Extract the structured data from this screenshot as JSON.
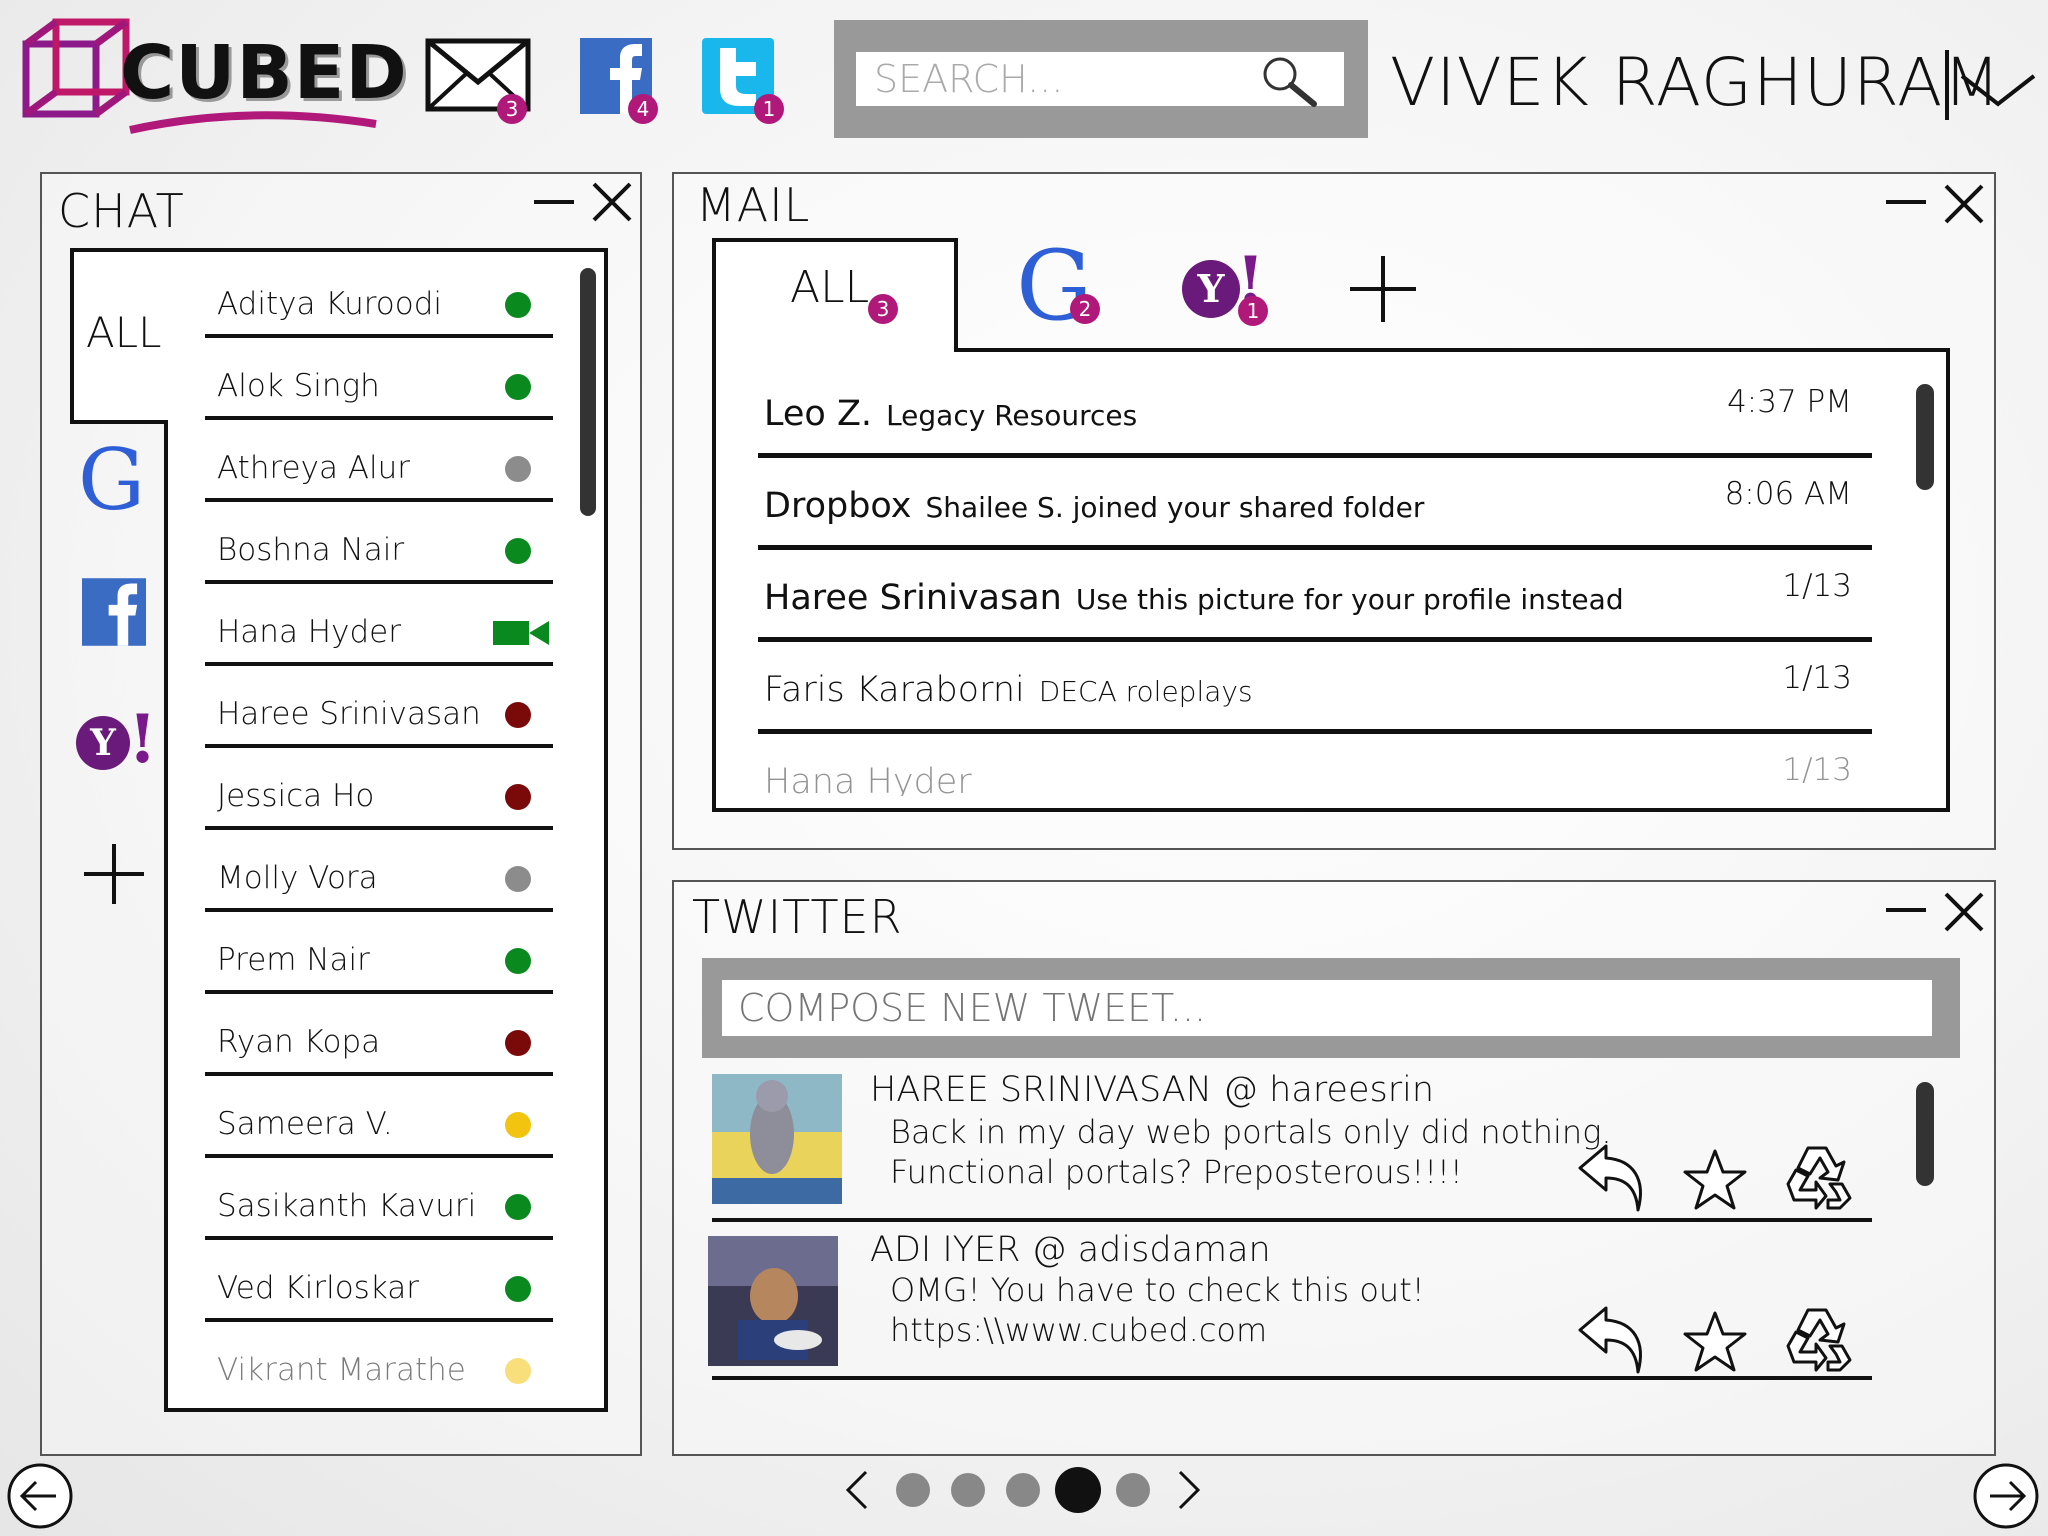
{
  "app": {
    "logo_text": "CUBED",
    "brand_color": "#b0197a"
  },
  "header": {
    "mail_badge": "3",
    "facebook_badge": "4",
    "twitter_badge": "1",
    "search_placeholder": "SEARCH...",
    "user_name": "VIVEK RAGHURAM"
  },
  "chat": {
    "title": "CHAT",
    "all_tab": "ALL",
    "contacts": [
      {
        "name": "Aditya Kuroodi",
        "status": "online"
      },
      {
        "name": "Alok Singh",
        "status": "online"
      },
      {
        "name": "Athreya Alur",
        "status": "away"
      },
      {
        "name": "Boshna Nair",
        "status": "online"
      },
      {
        "name": "Hana Hyder",
        "status": "video"
      },
      {
        "name": "Haree Srinivasan",
        "status": "busy"
      },
      {
        "name": "Jessica Ho",
        "status": "busy"
      },
      {
        "name": "Molly Vora",
        "status": "away"
      },
      {
        "name": "Prem Nair",
        "status": "online"
      },
      {
        "name": "Ryan Kopa",
        "status": "busy"
      },
      {
        "name": "Sameera V.",
        "status": "idle"
      },
      {
        "name": "Sasikanth Kavuri",
        "status": "online"
      },
      {
        "name": "Ved Kirloskar",
        "status": "online"
      },
      {
        "name": "Vikrant Marathe",
        "status": "idle"
      }
    ],
    "status_colors": {
      "online": "#0a8a1e",
      "away": "#8c8c8c",
      "busy": "#7a0a0a",
      "idle": "#f2c40f",
      "video": "#0a8a1e"
    }
  },
  "mail": {
    "title": "MAIL",
    "tabs": [
      {
        "label": "ALL",
        "badge": "3"
      },
      {
        "label": "G",
        "badge": "2"
      },
      {
        "label": "Y!",
        "badge": "1"
      }
    ],
    "messages": [
      {
        "sender": "Leo Z.",
        "subject": "Legacy Resources",
        "time": "4:37 PM"
      },
      {
        "sender": "Dropbox",
        "subject": "Shailee S. joined your shared folder",
        "time": "8:06 AM"
      },
      {
        "sender": "Haree Srinivasan",
        "subject": "Use this picture for your profile instead",
        "time": "1/13"
      },
      {
        "sender": "Faris Karaborni",
        "subject": "DECA roleplays",
        "time": "1/13"
      },
      {
        "sender": "Hana Hyder",
        "subject": "",
        "time": "1/13"
      }
    ]
  },
  "twitter": {
    "title": "TWITTER",
    "compose_placeholder": "COMPOSE NEW TWEET...",
    "tweets": [
      {
        "author": "HAREE SRINIVASAN @ hareesrin",
        "line1": "Back in my day web portals only did nothing.",
        "line2": "Functional portals? Preposterous!!!!"
      },
      {
        "author": "ADI IYER @ adisdaman",
        "line1": "OMG! You have to check this out!",
        "line2": "https:\\\\www.cubed.com"
      }
    ]
  },
  "pager": {
    "count": 5,
    "active_index": 3
  }
}
